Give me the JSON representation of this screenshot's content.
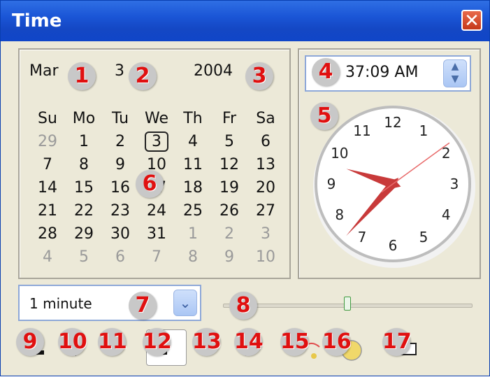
{
  "window": {
    "title": "Time",
    "close_label": "✕"
  },
  "calendar": {
    "month": "Mar",
    "day": "3",
    "year": "2004",
    "weekdays": [
      "Su",
      "Mo",
      "Tu",
      "We",
      "Th",
      "Fr",
      "Sa"
    ],
    "weeks": [
      [
        {
          "d": "29",
          "dim": true
        },
        {
          "d": "1"
        },
        {
          "d": "2"
        },
        {
          "d": "3",
          "sel": true
        },
        {
          "d": "4"
        },
        {
          "d": "5"
        },
        {
          "d": "6"
        }
      ],
      [
        {
          "d": "7"
        },
        {
          "d": "8"
        },
        {
          "d": "9"
        },
        {
          "d": "10"
        },
        {
          "d": "11"
        },
        {
          "d": "12"
        },
        {
          "d": "13"
        }
      ],
      [
        {
          "d": "14"
        },
        {
          "d": "15"
        },
        {
          "d": "16"
        },
        {
          "d": "17"
        },
        {
          "d": "18"
        },
        {
          "d": "19"
        },
        {
          "d": "20"
        }
      ],
      [
        {
          "d": "21"
        },
        {
          "d": "22"
        },
        {
          "d": "23"
        },
        {
          "d": "24"
        },
        {
          "d": "25"
        },
        {
          "d": "26"
        },
        {
          "d": "27"
        }
      ],
      [
        {
          "d": "28"
        },
        {
          "d": "29"
        },
        {
          "d": "30"
        },
        {
          "d": "31"
        },
        {
          "d": "1",
          "dim": true
        },
        {
          "d": "2",
          "dim": true
        },
        {
          "d": "3",
          "dim": true
        }
      ],
      [
        {
          "d": "4",
          "dim": true
        },
        {
          "d": "5",
          "dim": true
        },
        {
          "d": "6",
          "dim": true
        },
        {
          "d": "7",
          "dim": true
        },
        {
          "d": "8",
          "dim": true
        },
        {
          "d": "9",
          "dim": true
        },
        {
          "d": "10",
          "dim": true
        }
      ]
    ]
  },
  "time": {
    "value": "37:09 AM",
    "spin_up": "▲",
    "spin_down": "▼"
  },
  "clock": {
    "numbers": [
      "12",
      "1",
      "2",
      "3",
      "4",
      "5",
      "6",
      "7",
      "8",
      "9",
      "10",
      "11"
    ],
    "hour": 9.6,
    "minute": 37,
    "second": 9
  },
  "interval": {
    "value": "1 minute",
    "dropdown_glyph": "⌄"
  },
  "slider": {
    "fraction": 0.5
  },
  "badges": [
    "1",
    "2",
    "3",
    "4",
    "5",
    "6",
    "7",
    "8",
    "9",
    "10",
    "11",
    "12",
    "13",
    "14",
    "15",
    "16",
    "17"
  ],
  "colors": {
    "titlebar": "#1a55d6",
    "badge_text": "#e01010",
    "hands": "#c83a3a",
    "second_hand": "#e86a6a"
  }
}
